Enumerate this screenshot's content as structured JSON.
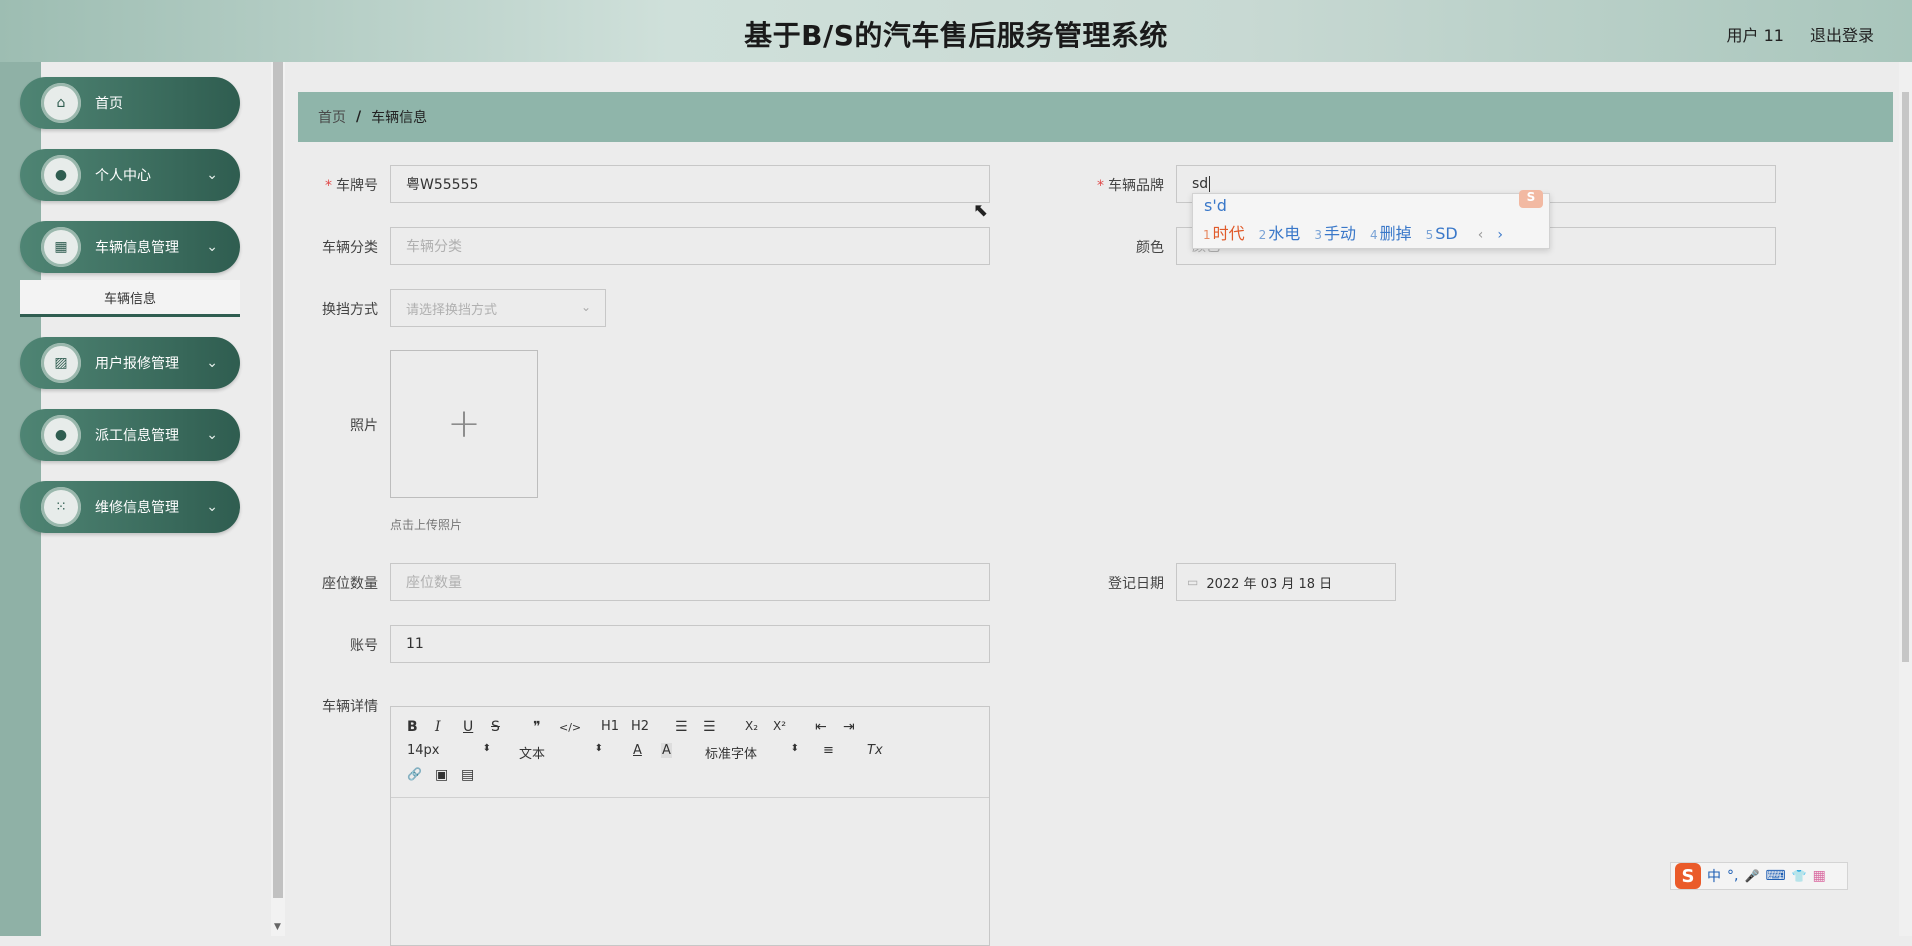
{
  "header": {
    "title": "基于B/S的汽车售后服务管理系统",
    "user": "用户 11",
    "logout": "退出登录"
  },
  "sidebar": {
    "items": [
      {
        "label": "首页",
        "icon": "home-icon"
      },
      {
        "label": "个人中心",
        "icon": "user-icon"
      },
      {
        "label": "车辆信息管理",
        "icon": "grid-icon"
      },
      {
        "label": "用户报修管理",
        "icon": "chart-icon"
      },
      {
        "label": "派工信息管理",
        "icon": "person-icon"
      },
      {
        "label": "维修信息管理",
        "icon": "apps-icon"
      }
    ],
    "subitem": "车辆信息"
  },
  "breadcrumb": {
    "home": "首页",
    "separator": "/",
    "current": "车辆信息"
  },
  "form": {
    "plate": {
      "label": "车牌号",
      "value": "粤W55555"
    },
    "brand": {
      "label": "车辆品牌",
      "value": "sd"
    },
    "category": {
      "label": "车辆分类",
      "placeholder": "车辆分类"
    },
    "color": {
      "label": "颜色",
      "placeholder": "颜色"
    },
    "gear": {
      "label": "换挡方式",
      "placeholder": "请选择换挡方式"
    },
    "photo": {
      "label": "照片",
      "hint": "点击上传照片",
      "plus": "+"
    },
    "seats": {
      "label": "座位数量",
      "placeholder": "座位数量"
    },
    "date": {
      "label": "登记日期",
      "value": "2022 年 03 月 18 日"
    },
    "account": {
      "label": "账号",
      "value": "11"
    },
    "details": {
      "label": "车辆详情"
    }
  },
  "editor": {
    "bold": "B",
    "italic": "I",
    "underline": "U",
    "strike": "S",
    "quote": "❞",
    "code": "</>",
    "h1": "H1",
    "h2": "H2",
    "ol": "☰",
    "ul": "☰",
    "sub": "X₂",
    "sup": "X²",
    "outdent": "⇤",
    "indent": "⇥",
    "size": "14px",
    "header_select": "文本",
    "font_color": "A",
    "bg_color": "A",
    "font": "标准字体",
    "align": "≡",
    "clear": "Tx",
    "link": "🔗",
    "image": "▣",
    "video": "▤"
  },
  "ime": {
    "composition": "s'd",
    "candidates": [
      {
        "n": "1",
        "text": "时代"
      },
      {
        "n": "2",
        "text": "水电"
      },
      {
        "n": "3",
        "text": "手动"
      },
      {
        "n": "4",
        "text": "删掉"
      },
      {
        "n": "5",
        "text": "SD"
      }
    ],
    "bar": {
      "logo": "S",
      "mode": "中",
      "punct": "°,",
      "voice": "🎤",
      "keyboard": "⌨",
      "skin": "👕",
      "menu": "▦"
    }
  }
}
